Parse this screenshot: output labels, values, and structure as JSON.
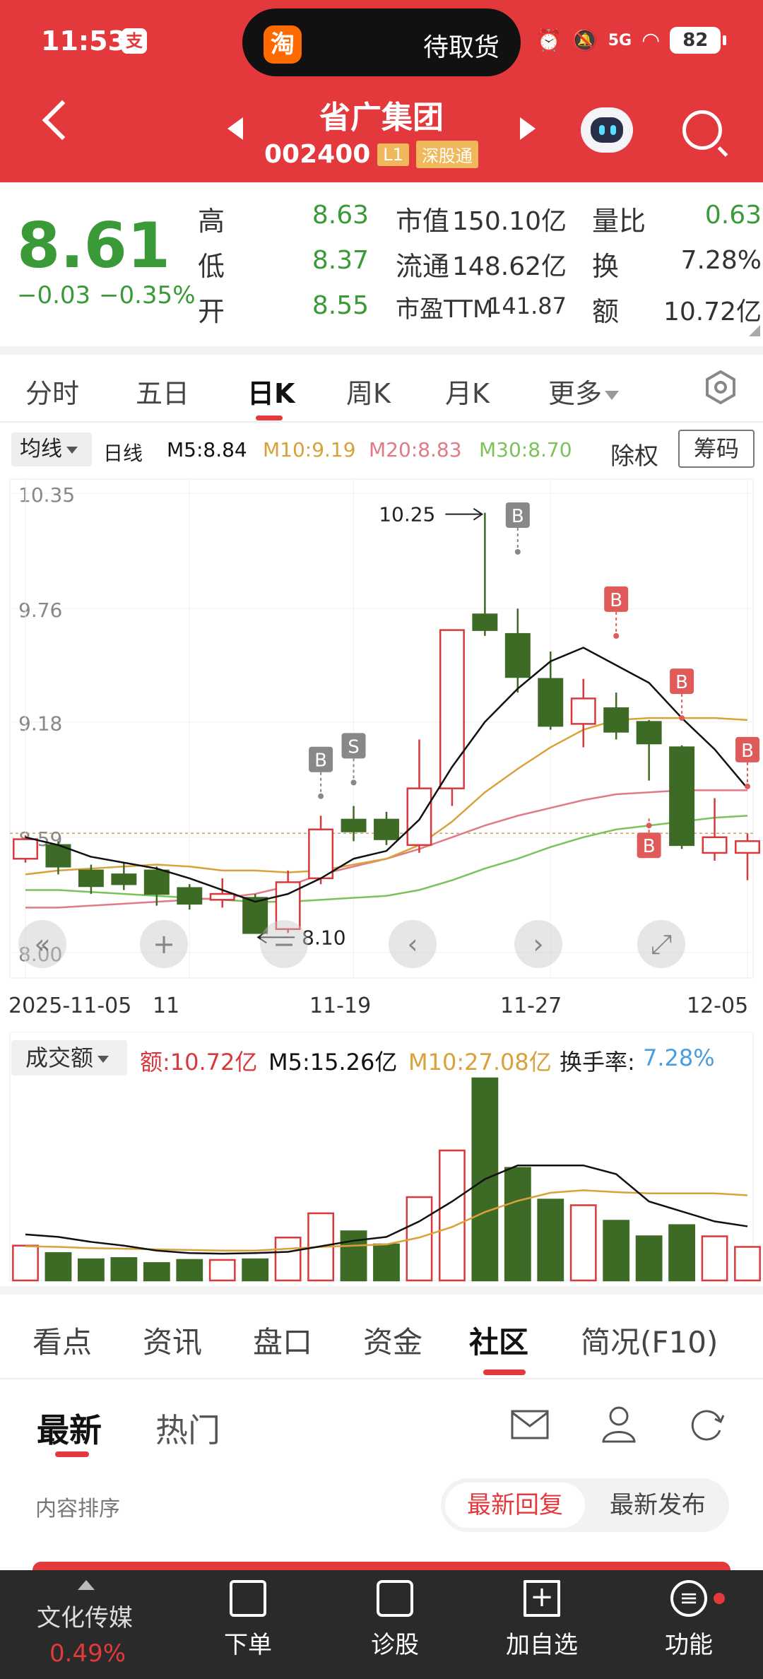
{
  "status_bar": {
    "time": "11:53",
    "app_badge": "支",
    "island_app": "淘",
    "island_text": "待取货",
    "battery": "82",
    "network": "5G"
  },
  "header": {
    "stock_name": "省广集团",
    "stock_code": "002400",
    "tag_level": "L1",
    "tag_connect": "深股通"
  },
  "quote": {
    "price": "8.61",
    "change": "−0.03",
    "change_pct": "−0.35%",
    "high_label": "高",
    "high": "8.63",
    "low_label": "低",
    "low": "8.37",
    "open_label": "开",
    "open": "8.55",
    "mktcap_label": "市值",
    "mktcap": "150.10亿",
    "float_label": "流通",
    "float": "148.62亿",
    "pe_label": "市盈TTM",
    "pe": "141.87",
    "vol_ratio_label": "量比",
    "vol_ratio": "0.63",
    "turnover_label": "换",
    "turnover": "7.28%",
    "amount_label": "额",
    "amount": "10.72亿"
  },
  "chart_tabs": [
    "分时",
    "五日",
    "日K",
    "周K",
    "月K",
    "更多"
  ],
  "ma_row": {
    "select": "均线",
    "period": "日线",
    "m5": "M5:8.84",
    "m10": "M10:9.19",
    "m20": "M20:8.83",
    "m30": "M30:8.70",
    "rights": "除权",
    "chips": "筹码"
  },
  "colors": {
    "up": "#d9393c",
    "down": "#3d6b25",
    "brand": "#e3393c",
    "ma5": "#111111",
    "ma10": "#d9a13a",
    "ma20": "#e07a86",
    "ma30": "#7cc25a"
  },
  "chart_data": {
    "type": "candlestick",
    "y_ticks": [
      "10.35",
      "9.76",
      "9.18",
      "8.59",
      "8.00"
    ],
    "ylim": [
      8.0,
      10.35
    ],
    "x_tick_labels": [
      "2025-11-05",
      "11",
      "11-19",
      "11-27",
      "12-05"
    ],
    "annotations": {
      "max_label": "10.25",
      "min_label": "8.10"
    },
    "candles": [
      {
        "o": 8.48,
        "c": 8.58,
        "h": 8.6,
        "l": 8.46,
        "dir": "up"
      },
      {
        "o": 8.55,
        "c": 8.44,
        "h": 8.57,
        "l": 8.4,
        "dir": "down"
      },
      {
        "o": 8.42,
        "c": 8.34,
        "h": 8.45,
        "l": 8.3,
        "dir": "down"
      },
      {
        "o": 8.4,
        "c": 8.35,
        "h": 8.46,
        "l": 8.32,
        "dir": "down"
      },
      {
        "o": 8.42,
        "c": 8.3,
        "h": 8.44,
        "l": 8.24,
        "dir": "down"
      },
      {
        "o": 8.33,
        "c": 8.25,
        "h": 8.35,
        "l": 8.22,
        "dir": "down"
      },
      {
        "o": 8.27,
        "c": 8.3,
        "h": 8.38,
        "l": 8.23,
        "dir": "up"
      },
      {
        "o": 8.28,
        "c": 8.1,
        "h": 8.3,
        "l": 8.1,
        "dir": "down"
      },
      {
        "o": 8.12,
        "c": 8.36,
        "h": 8.42,
        "l": 8.1,
        "dir": "up"
      },
      {
        "o": 8.38,
        "c": 8.63,
        "h": 8.7,
        "l": 8.35,
        "dir": "up"
      },
      {
        "o": 8.68,
        "c": 8.62,
        "h": 8.75,
        "l": 8.57,
        "dir": "down"
      },
      {
        "o": 8.68,
        "c": 8.58,
        "h": 8.72,
        "l": 8.55,
        "dir": "down"
      },
      {
        "o": 8.55,
        "c": 8.84,
        "h": 9.09,
        "l": 8.51,
        "dir": "up"
      },
      {
        "o": 8.84,
        "c": 9.65,
        "h": 9.65,
        "l": 8.75,
        "dir": "up"
      },
      {
        "o": 9.73,
        "c": 9.65,
        "h": 10.25,
        "l": 9.62,
        "dir": "down"
      },
      {
        "o": 9.63,
        "c": 9.41,
        "h": 9.76,
        "l": 9.33,
        "dir": "down"
      },
      {
        "o": 9.4,
        "c": 9.16,
        "h": 9.54,
        "l": 9.14,
        "dir": "down"
      },
      {
        "o": 9.17,
        "c": 9.3,
        "h": 9.4,
        "l": 9.05,
        "dir": "up"
      },
      {
        "o": 9.25,
        "c": 9.13,
        "h": 9.33,
        "l": 9.09,
        "dir": "down"
      },
      {
        "o": 9.18,
        "c": 9.07,
        "h": 9.19,
        "l": 8.88,
        "dir": "down"
      },
      {
        "o": 9.05,
        "c": 8.55,
        "h": 9.06,
        "l": 8.53,
        "dir": "down"
      },
      {
        "o": 8.51,
        "c": 8.59,
        "h": 8.79,
        "l": 8.47,
        "dir": "up"
      },
      {
        "o": 8.51,
        "c": 8.57,
        "h": 8.61,
        "l": 8.37,
        "dir": "up"
      }
    ],
    "ma5": [
      8.59,
      8.55,
      8.49,
      8.46,
      8.43,
      8.38,
      8.32,
      8.26,
      8.3,
      8.38,
      8.48,
      8.52,
      8.68,
      8.95,
      9.18,
      9.35,
      9.49,
      9.56,
      9.47,
      9.38,
      9.2,
      9.04,
      8.84
    ],
    "ma10": [
      8.4,
      8.42,
      8.43,
      8.44,
      8.45,
      8.44,
      8.42,
      8.42,
      8.41,
      8.42,
      8.45,
      8.48,
      8.55,
      8.67,
      8.82,
      8.94,
      9.05,
      9.14,
      9.19,
      9.2,
      9.2,
      9.2,
      9.19
    ],
    "ma20": [
      8.23,
      8.23,
      8.24,
      8.25,
      8.26,
      8.27,
      8.28,
      8.3,
      8.34,
      8.4,
      8.44,
      8.48,
      8.53,
      8.59,
      8.65,
      8.7,
      8.74,
      8.78,
      8.81,
      8.82,
      8.83,
      8.83,
      8.83
    ],
    "ma30": [
      8.32,
      8.32,
      8.31,
      8.3,
      8.29,
      8.28,
      8.27,
      8.26,
      8.26,
      8.27,
      8.28,
      8.29,
      8.32,
      8.37,
      8.43,
      8.48,
      8.54,
      8.59,
      8.63,
      8.65,
      8.67,
      8.69,
      8.7
    ],
    "signals": [
      {
        "i": 9,
        "label": "B",
        "color": "#888888",
        "pos": "above",
        "price": 8.8
      },
      {
        "i": 10,
        "label": "S",
        "color": "#888888",
        "pos": "above",
        "price": 8.87
      },
      {
        "i": 15,
        "label": "B",
        "color": "#888888",
        "pos": "above",
        "price": 10.05
      },
      {
        "i": 18,
        "label": "B",
        "color": "#e05a5a",
        "pos": "above",
        "price": 9.62
      },
      {
        "i": 20,
        "label": "B",
        "color": "#e05a5a",
        "pos": "above",
        "price": 9.2
      },
      {
        "i": 19,
        "label": "B",
        "color": "#e05a5a",
        "pos": "below",
        "price": 8.65
      },
      {
        "i": 22,
        "label": "B",
        "color": "#e05a5a",
        "pos": "above",
        "price": 8.85
      }
    ]
  },
  "volume": {
    "select": "成交额",
    "amount": "额:10.72亿",
    "m5": "M5:15.26亿",
    "m10": "M10:27.08亿",
    "turnover_label": "换手率:",
    "turnover_value": "7.28%",
    "values": [
      5.6,
      4.4,
      3.4,
      3.6,
      2.8,
      3.3,
      3.3,
      3.4,
      6.9,
      10.8,
      7.9,
      5.8,
      13.4,
      20.9,
      32.5,
      18.1,
      13.0,
      12.1,
      9.6,
      7.1,
      8.9,
      7.1,
      5.4
    ],
    "ma5": [
      7.4,
      7.0,
      6.2,
      5.6,
      4.8,
      4.4,
      4.3,
      4.4,
      4.6,
      5.5,
      6.4,
      7.0,
      9.5,
      12.7,
      16.3,
      18.5,
      18.5,
      18.5,
      17.1,
      12.7,
      11.1,
      9.5,
      8.7
    ],
    "ma10": [
      5.5,
      5.4,
      5.2,
      5.1,
      5.0,
      4.9,
      4.8,
      4.8,
      5.1,
      5.4,
      5.6,
      5.8,
      6.9,
      8.6,
      11.0,
      12.8,
      14.1,
      14.5,
      14.2,
      14.0,
      14.0,
      14.0,
      13.7
    ]
  },
  "info_tabs": [
    "看点",
    "资讯",
    "盘口",
    "资金",
    "社区",
    "简况(F10)"
  ],
  "sub_tabs": [
    "最新",
    "热门"
  ],
  "sort": {
    "label": "内容排序",
    "option_active": "最新回复",
    "option_other": "最新发布"
  },
  "bottom_bar": {
    "sector_name": "文化传媒",
    "sector_pct": "0.49%",
    "order": "下单",
    "diagnose": "诊股",
    "add_watch": "加自选",
    "functions": "功能"
  }
}
